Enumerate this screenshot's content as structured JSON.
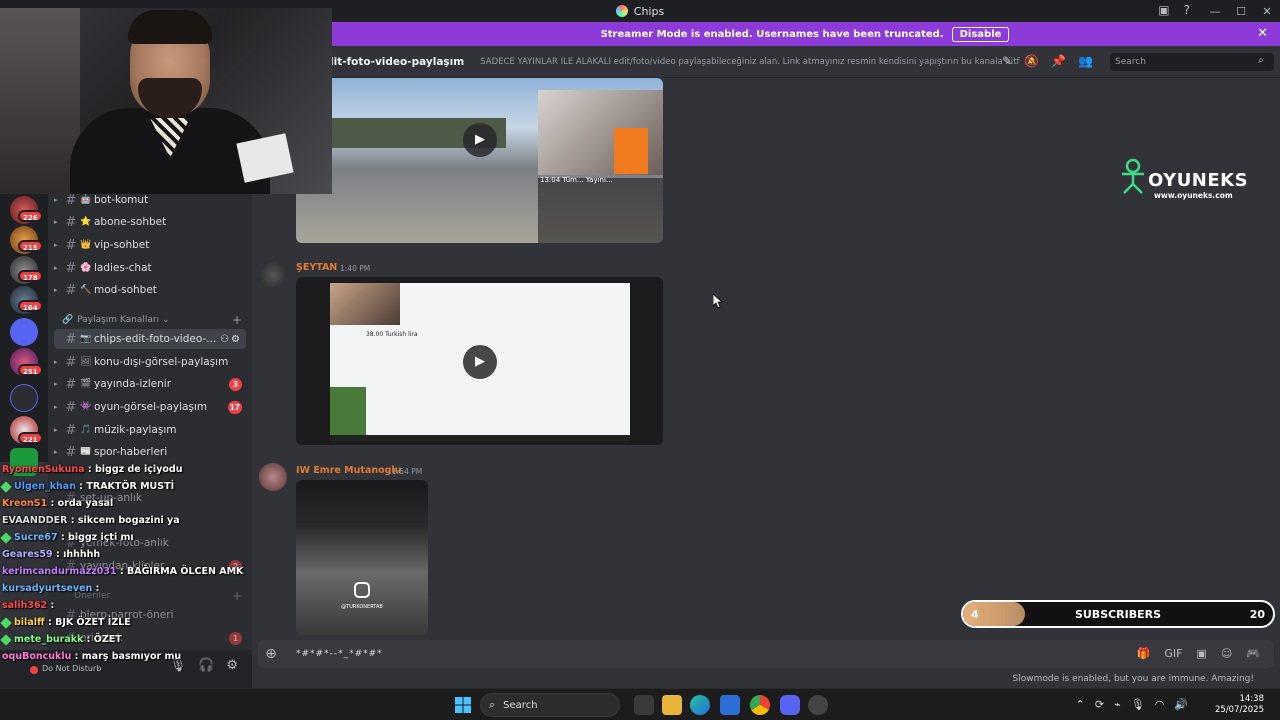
{
  "window": {
    "title": "Chips"
  },
  "banner": {
    "text": "Streamer Mode is enabled. Usernames have been truncated.",
    "disable_label": "Disable"
  },
  "channel_header": {
    "name": "lit-foto-video-paylaşım",
    "topic": "SADECE YAYINLAR İLE ALAKALI edit/foto/video paylaşabileceğiniz alan. Link atmayınız resmin kendisini yapıştırın bu kanala lütfen, ...",
    "search_placeholder": "Search"
  },
  "servers": [
    {
      "badge": "226"
    },
    {
      "badge": "215"
    },
    {
      "badge": "178"
    },
    {
      "badge": "164"
    },
    {
      "badge": ""
    },
    {
      "badge": "251"
    },
    {
      "badge": ""
    },
    {
      "badge": "221"
    }
  ],
  "channels": [
    {
      "label": "bot-komut",
      "emoji": "🤖",
      "count": ""
    },
    {
      "label": "abone-sohbet",
      "emoji": "⭐",
      "count": ""
    },
    {
      "label": "vip-sohbet",
      "emoji": "👑",
      "count": ""
    },
    {
      "label": "ladies-chat",
      "emoji": "🌸",
      "count": ""
    },
    {
      "label": "mod-sohbet",
      "emoji": "🔨",
      "count": ""
    }
  ],
  "category": {
    "label": "Paylaşım Kanalları"
  },
  "share_channels": [
    {
      "label": "chips-edit-foto-video-...",
      "emoji": "📷",
      "count": "",
      "active": true
    },
    {
      "label": "konu-dışı-görsel-paylaşım",
      "emoji": "🖼",
      "count": ""
    },
    {
      "label": "yayında-izlenir",
      "emoji": "🎬",
      "count": "3"
    },
    {
      "label": "oyun-görsel-paylaşım",
      "emoji": "👾",
      "count": "17"
    },
    {
      "label": "müzik-paylaşım",
      "emoji": "🎵",
      "count": ""
    },
    {
      "label": "spor-haberleri",
      "emoji": "📰",
      "count": ""
    }
  ],
  "hidden_channels": [
    {
      "label": "set-up-anlık",
      "count": ""
    },
    {
      "label": "yemek-foto-anlık",
      "count": ""
    },
    {
      "label": "yayından-klipler",
      "count": "2"
    },
    {
      "label": "blerp-parrot-öneri",
      "count": ""
    },
    {
      "label": "eri-istek",
      "count": "1"
    }
  ],
  "hidden_category": {
    "label": "Öneriler"
  },
  "user": {
    "status": "Do Not Disturb"
  },
  "messages": [
    {
      "author": "ŞEYTAN",
      "time": "1:40 PM"
    },
    {
      "author": "IW Emre Mutanoglu",
      "time": "1:54 PM"
    }
  ],
  "video1": {
    "overlay_text": "13:04 Tüm... Yayını..."
  },
  "video2": {
    "price": "38.00 Turkish lira"
  },
  "video3": {
    "caption": "@TURKONERTAB"
  },
  "composer": {
    "text": "*#*#*--*_*#*#*"
  },
  "slowmode": "Slowmode is enabled, but you are immune. Amazing!",
  "logo": {
    "name": "OYUNEKS",
    "url": "www.oyuneks.com"
  },
  "subscribers": {
    "current": "4",
    "label": "SUBSCRIBERS",
    "goal": "20",
    "progress": 0.2
  },
  "chat": [
    {
      "user": "RyomenSukuna",
      "msg": "biggz de içiyodu",
      "color": "#ff4a4a",
      "badge": false
    },
    {
      "user": "Ulgen_khan",
      "msg": "TRAKTÖR MUSTİ",
      "color": "#4a9eff",
      "badge": true
    },
    {
      "user": "KreonS1",
      "msg": "orda yasal",
      "color": "#ff8a3d",
      "badge": false
    },
    {
      "user": "EVAANDDER",
      "msg": "sikcem bogazini ya",
      "color": "#dbdee1",
      "badge": false
    },
    {
      "user": "Sucre67",
      "msg": "biggz içti mı",
      "color": "#6ab7ff",
      "badge": true
    },
    {
      "user": "Geares59",
      "msg": "ıhhhhh",
      "color": "#b0b0ff",
      "badge": false
    },
    {
      "user": "kerimcandurmazz031",
      "msg": "BAĞIRMA ÖLCEN AMK",
      "color": "#c77dff",
      "badge": false
    },
    {
      "user": "kursadyurtseven",
      "msg": "",
      "color": "#6ab7ff",
      "badge": false
    },
    {
      "user": "salih362",
      "msg": "",
      "color": "#ff4a4a",
      "badge": false
    },
    {
      "user": "bilalff",
      "msg": "BJK ÖZET İZLE",
      "color": "#ffd24a",
      "badge": true
    },
    {
      "user": "mete_burakk",
      "msg": "ÖZET",
      "color": "#7dff8a",
      "badge": true
    },
    {
      "user": "oquBoncuklu",
      "msg": "marş basmıyor mu",
      "color": "#ff7ad9",
      "badge": false
    }
  ],
  "taskbar": {
    "search_label": "Search",
    "time": "14:38",
    "date": "25/07/2025"
  },
  "colors": {
    "banner": "#8c3ad8",
    "sidebar": "#2b2d31",
    "main": "#313338",
    "unread": "#f23f43",
    "author": "#e07c2f"
  }
}
